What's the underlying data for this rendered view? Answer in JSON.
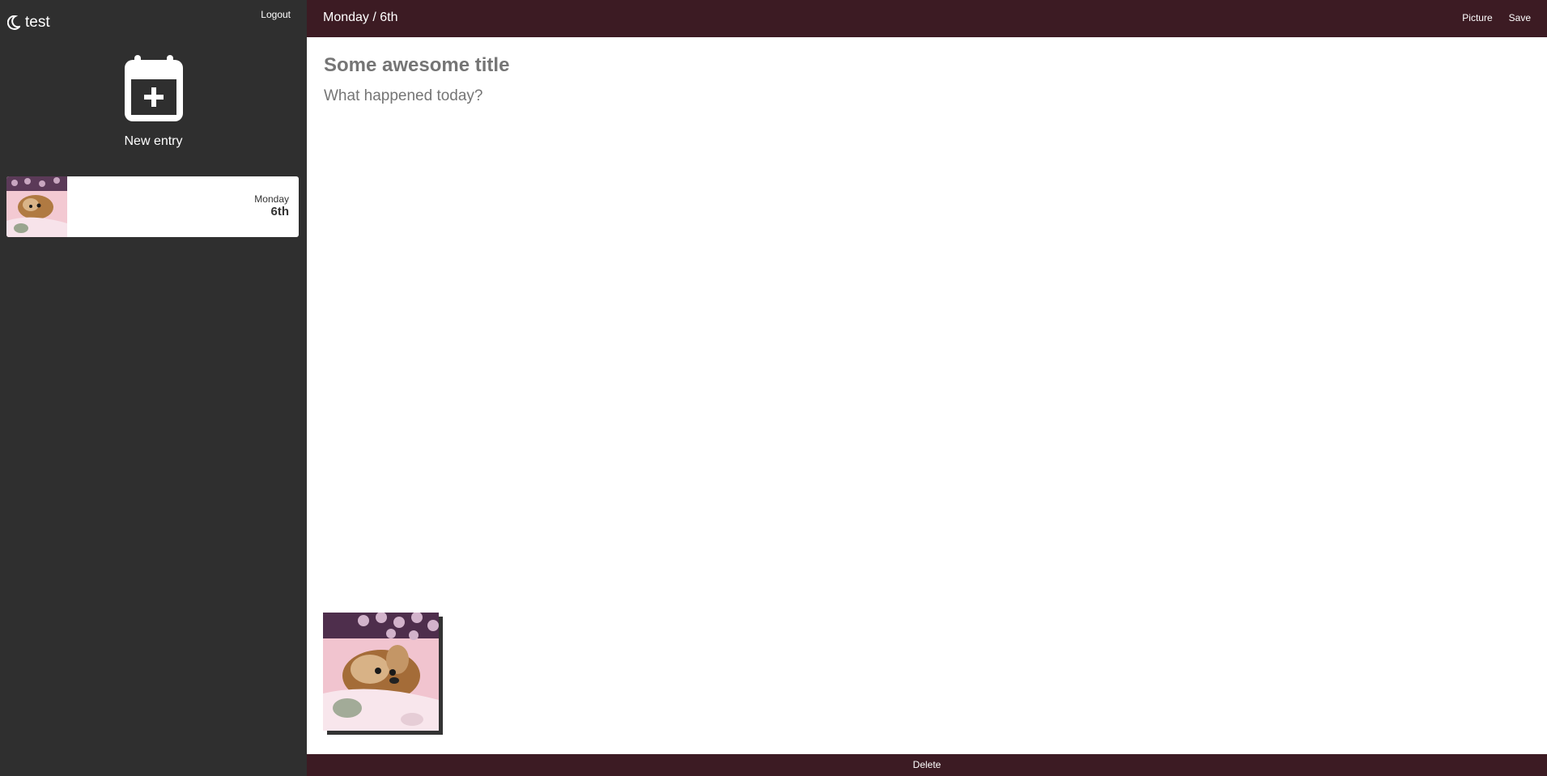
{
  "sidebar": {
    "brand": "test",
    "logout_label": "Logout",
    "new_entry_label": "New entry",
    "entries": [
      {
        "day": "Monday",
        "date": "6th"
      }
    ]
  },
  "topbar": {
    "title": "Monday / 6th",
    "picture_label": "Picture",
    "save_label": "Save"
  },
  "editor": {
    "title_placeholder": "Some awesome title",
    "body_placeholder": "What happened today?"
  },
  "bottombar": {
    "delete_label": "Delete"
  },
  "colors": {
    "sidebar_bg": "#2f2f2f",
    "bar_bg": "#3c1b23",
    "placeholder": "#757575"
  },
  "icons": {
    "brand": "moon-icon",
    "new_entry": "calendar-plus-icon"
  }
}
